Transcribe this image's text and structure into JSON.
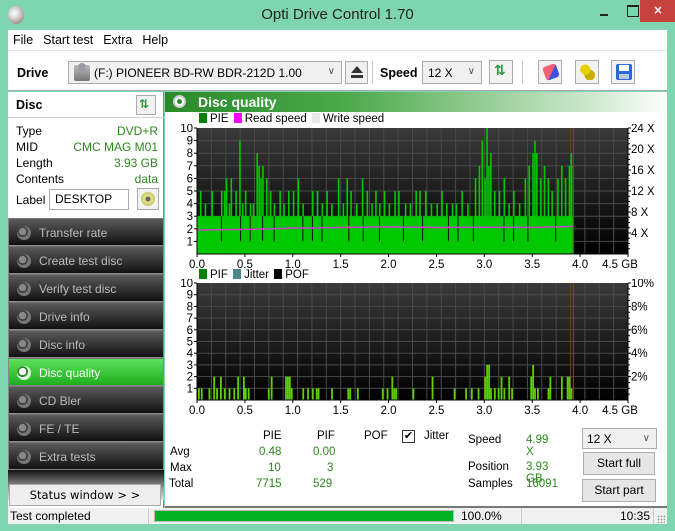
{
  "window": {
    "title": "Opti Drive Control 1.70",
    "controls": {
      "minimize": "minimize",
      "maximize": "maximize",
      "close": "×"
    }
  },
  "menu": [
    "File",
    "Start test",
    "Extra",
    "Help"
  ],
  "toolbar": {
    "drive_label": "Drive",
    "drive_value": "(F:)  PIONEER BD-RW   BDR-212D 1.00",
    "speed_label": "Speed",
    "speed_value": "12 X",
    "icons": [
      "refresh-icon",
      "eraser-icon",
      "settings-icon",
      "save-icon"
    ]
  },
  "disc": {
    "header": "Disc",
    "fields": [
      {
        "key": "Type",
        "value": "DVD+R"
      },
      {
        "key": "MID",
        "value": "CMC MAG M01"
      },
      {
        "key": "Length",
        "value": "3.93 GB"
      },
      {
        "key": "Contents",
        "value": "data"
      }
    ],
    "label_key": "Label",
    "label_value": "DESKTOP"
  },
  "nav": {
    "items": [
      {
        "label": "Transfer rate",
        "active": false
      },
      {
        "label": "Create test disc",
        "active": false
      },
      {
        "label": "Verify test disc",
        "active": false
      },
      {
        "label": "Drive info",
        "active": false
      },
      {
        "label": "Disc info",
        "active": false
      },
      {
        "label": "Disc quality",
        "active": true
      },
      {
        "label": "CD Bler",
        "active": false
      },
      {
        "label": "FE / TE",
        "active": false
      },
      {
        "label": "Extra tests",
        "active": false
      }
    ],
    "status_window_button": "Status window > >"
  },
  "main": {
    "title": "Disc quality",
    "stats": {
      "headers": [
        "PIE",
        "PIF",
        "POF",
        "Jitter"
      ],
      "jitter_checked": true,
      "rows": [
        {
          "label": "Avg",
          "pie": "0.48",
          "pif": "0.00"
        },
        {
          "label": "Max",
          "pie": "10",
          "pif": "3"
        },
        {
          "label": "Total",
          "pie": "7715",
          "pif": "529"
        }
      ],
      "speed_label": "Speed",
      "speed_value": "4.99 X",
      "position_label": "Position",
      "position_value": "3.93 GB",
      "samples_label": "Samples",
      "samples_value": "16091",
      "speed_select": "12 X",
      "start_full": "Start full",
      "start_part": "Start part"
    }
  },
  "chart_data": [
    {
      "type": "bar",
      "title": "PIE",
      "legend": [
        {
          "name": "PIE",
          "color": "#008000"
        },
        {
          "name": "Read speed",
          "color": "#ff00ff"
        },
        {
          "name": "Write speed",
          "color": "#e8e8e8"
        }
      ],
      "xlabel": "GB",
      "xlim": [
        0,
        4.5
      ],
      "ylim": [
        0,
        10
      ],
      "y2lim": [
        0,
        24
      ],
      "x_ticks": [
        "0.0",
        "0.5",
        "1.0",
        "1.5",
        "2.0",
        "2.5",
        "3.0",
        "3.5",
        "4.0",
        "4.5 GB"
      ],
      "y_ticks": [
        "1",
        "2",
        "3",
        "4",
        "5",
        "6",
        "7",
        "8",
        "9",
        "10"
      ],
      "y2_ticks": [
        "4 X",
        "8 X",
        "12 X",
        "16 X",
        "20 X",
        "24 X"
      ],
      "end_marker_gb": 3.93,
      "baseline_pie": 3,
      "spikes": [
        [
          0.03,
          5
        ],
        [
          0.08,
          4
        ],
        [
          0.15,
          5
        ],
        [
          0.2,
          3
        ],
        [
          0.25,
          5
        ],
        [
          0.28,
          5
        ],
        [
          0.3,
          6
        ],
        [
          0.33,
          4
        ],
        [
          0.35,
          6
        ],
        [
          0.4,
          5
        ],
        [
          0.44,
          9
        ],
        [
          0.47,
          4
        ],
        [
          0.5,
          5
        ],
        [
          0.55,
          4
        ],
        [
          0.58,
          4
        ],
        [
          0.62,
          8
        ],
        [
          0.64,
          7
        ],
        [
          0.66,
          6
        ],
        [
          0.68,
          7
        ],
        [
          0.72,
          6
        ],
        [
          0.76,
          5
        ],
        [
          0.8,
          4
        ],
        [
          0.86,
          5
        ],
        [
          0.9,
          4
        ],
        [
          0.95,
          5
        ],
        [
          1.0,
          5
        ],
        [
          1.05,
          6
        ],
        [
          1.1,
          4
        ],
        [
          1.2,
          5
        ],
        [
          1.25,
          5
        ],
        [
          1.3,
          4
        ],
        [
          1.35,
          5
        ],
        [
          1.4,
          4
        ],
        [
          1.47,
          6
        ],
        [
          1.52,
          4
        ],
        [
          1.56,
          6
        ],
        [
          1.6,
          5
        ],
        [
          1.66,
          4
        ],
        [
          1.72,
          6
        ],
        [
          1.77,
          5
        ],
        [
          1.82,
          4
        ],
        [
          1.86,
          5
        ],
        [
          1.9,
          4
        ],
        [
          1.95,
          5
        ],
        [
          2.0,
          4
        ],
        [
          2.06,
          5
        ],
        [
          2.1,
          5
        ],
        [
          2.17,
          4
        ],
        [
          2.22,
          4
        ],
        [
          2.28,
          5
        ],
        [
          2.32,
          5
        ],
        [
          2.38,
          5
        ],
        [
          2.44,
          4
        ],
        [
          2.5,
          4
        ],
        [
          2.55,
          5
        ],
        [
          2.6,
          4
        ],
        [
          2.66,
          4
        ],
        [
          2.7,
          4
        ],
        [
          2.76,
          5
        ],
        [
          2.82,
          4
        ],
        [
          2.9,
          6
        ],
        [
          2.94,
          7
        ],
        [
          2.97,
          9
        ],
        [
          3.0,
          6
        ],
        [
          3.02,
          10
        ],
        [
          3.04,
          7
        ],
        [
          3.06,
          8
        ],
        [
          3.1,
          5
        ],
        [
          3.15,
          5
        ],
        [
          3.2,
          6
        ],
        [
          3.25,
          4
        ],
        [
          3.3,
          5
        ],
        [
          3.36,
          4
        ],
        [
          3.42,
          6
        ],
        [
          3.46,
          7
        ],
        [
          3.5,
          8
        ],
        [
          3.52,
          9
        ],
        [
          3.54,
          8
        ],
        [
          3.58,
          6
        ],
        [
          3.62,
          7
        ],
        [
          3.66,
          6
        ],
        [
          3.7,
          5
        ],
        [
          3.76,
          6
        ],
        [
          3.8,
          7
        ],
        [
          3.84,
          6
        ],
        [
          3.88,
          7
        ],
        [
          3.9,
          8
        ],
        [
          3.92,
          7
        ]
      ],
      "read_speed_x": [
        [
          0,
          1.9
        ],
        [
          0.5,
          1.95
        ],
        [
          1.0,
          2.05
        ],
        [
          1.5,
          2.1
        ],
        [
          2.0,
          2.15
        ],
        [
          2.5,
          2.1
        ],
        [
          3.0,
          2.12
        ],
        [
          3.5,
          2.1
        ],
        [
          3.93,
          2.18
        ]
      ]
    },
    {
      "type": "bar",
      "title": "PIF",
      "legend": [
        {
          "name": "PIF",
          "color": "#008000"
        },
        {
          "name": "Jitter",
          "color": "#4a8a8a"
        },
        {
          "name": "POF",
          "color": "#000000"
        }
      ],
      "xlabel": "GB",
      "xlim": [
        0,
        4.5
      ],
      "ylim": [
        0,
        10
      ],
      "y2lim": [
        0,
        10
      ],
      "x_ticks": [
        "0.0",
        "0.5",
        "1.0",
        "1.5",
        "2.0",
        "2.5",
        "3.0",
        "3.5",
        "4.0",
        "4.5 GB"
      ],
      "y_ticks": [
        "1",
        "2",
        "3",
        "4",
        "5",
        "6",
        "7",
        "8",
        "9",
        "10"
      ],
      "y2_ticks": [
        "2%",
        "4%",
        "6%",
        "8%",
        "10%"
      ],
      "end_marker_gb": 3.93,
      "bars": [
        [
          0.01,
          1
        ],
        [
          0.04,
          1
        ],
        [
          0.12,
          1
        ],
        [
          0.17,
          2
        ],
        [
          0.2,
          1
        ],
        [
          0.24,
          2
        ],
        [
          0.28,
          1
        ],
        [
          0.33,
          1
        ],
        [
          0.38,
          1
        ],
        [
          0.42,
          2
        ],
        [
          0.48,
          2
        ],
        [
          0.49,
          1
        ],
        [
          0.5,
          1
        ],
        [
          0.53,
          1
        ],
        [
          0.74,
          1
        ],
        [
          0.77,
          2
        ],
        [
          0.92,
          2
        ],
        [
          0.94,
          2
        ],
        [
          0.96,
          2
        ],
        [
          0.98,
          1
        ],
        [
          1.1,
          1
        ],
        [
          1.15,
          1
        ],
        [
          1.2,
          1
        ],
        [
          1.24,
          1
        ],
        [
          1.26,
          1
        ],
        [
          1.4,
          1
        ],
        [
          1.57,
          1
        ],
        [
          1.59,
          1
        ],
        [
          1.67,
          1
        ],
        [
          1.93,
          1
        ],
        [
          1.98,
          1
        ],
        [
          2.03,
          2
        ],
        [
          2.05,
          1
        ],
        [
          2.07,
          1
        ],
        [
          2.25,
          1
        ],
        [
          2.45,
          2
        ],
        [
          2.68,
          1
        ],
        [
          2.8,
          1
        ],
        [
          2.86,
          1
        ],
        [
          2.93,
          1
        ],
        [
          3.0,
          2
        ],
        [
          3.02,
          3
        ],
        [
          3.04,
          3
        ],
        [
          3.06,
          1
        ],
        [
          3.1,
          1
        ],
        [
          3.14,
          1
        ],
        [
          3.17,
          2
        ],
        [
          3.2,
          1
        ],
        [
          3.25,
          2
        ],
        [
          3.28,
          1
        ],
        [
          3.48,
          2
        ],
        [
          3.5,
          3
        ],
        [
          3.52,
          1
        ],
        [
          3.55,
          1
        ],
        [
          3.66,
          1
        ],
        [
          3.68,
          2
        ],
        [
          3.8,
          2
        ],
        [
          3.86,
          2
        ],
        [
          3.88,
          2
        ],
        [
          3.9,
          1
        ]
      ]
    }
  ],
  "statusbar": {
    "message": "Test completed",
    "progress_percent": 100,
    "progress_text": "100.0%",
    "time": "10:35"
  }
}
